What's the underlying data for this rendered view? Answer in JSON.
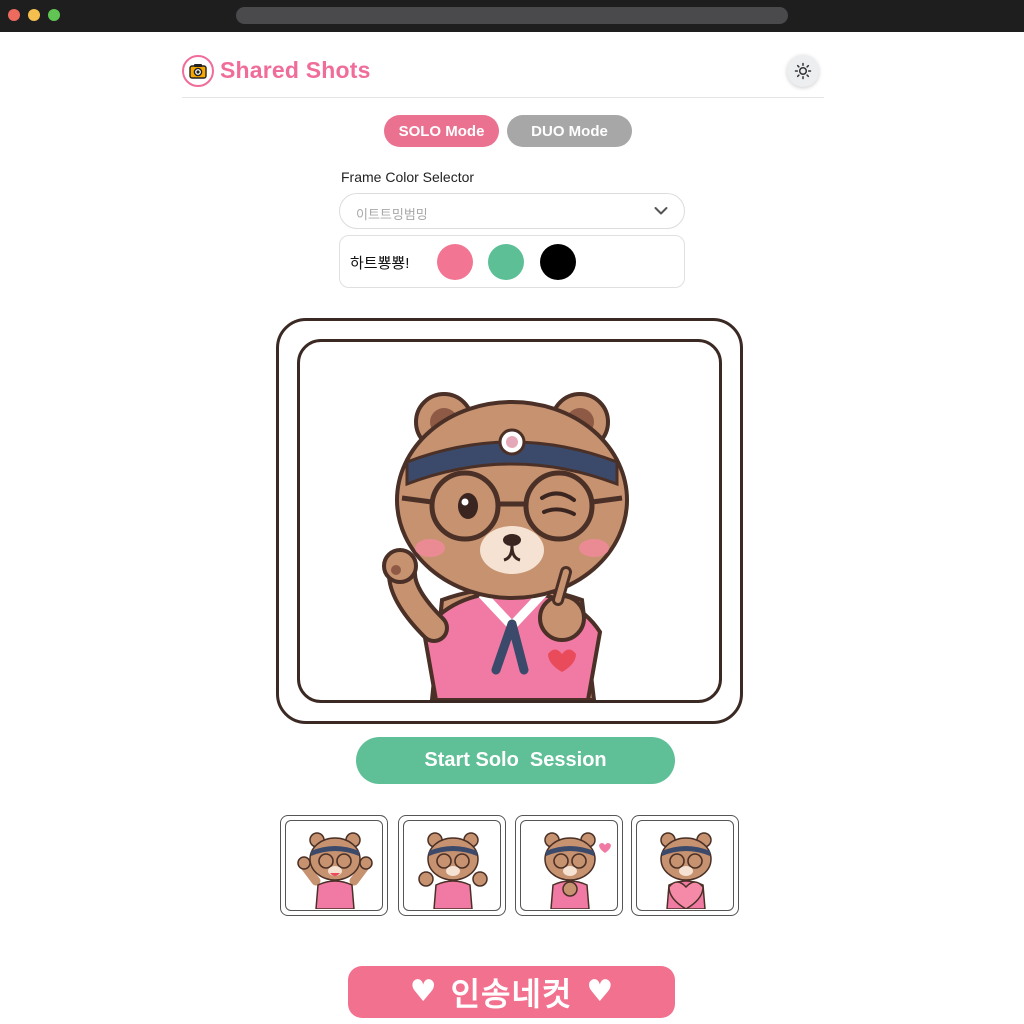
{
  "header": {
    "title": "Shared Shots",
    "logo_icon": "camera-icon",
    "theme_icon": "sun-icon"
  },
  "modes": {
    "solo_label": "SOLO Mode",
    "duo_label": "DUO Mode",
    "selected": "SOLO Mode"
  },
  "frame_selector": {
    "label": "Frame Color Selector",
    "selected_value": "이트트밍범밍",
    "swatch_label": "하트뿅뿅!",
    "swatches": [
      "#f27593",
      "#5cbf96",
      "#000000"
    ]
  },
  "preview": {
    "frame_color": "#3b2a24",
    "character": "bear-character"
  },
  "actions": {
    "start_label": "Start Solo  Session"
  },
  "thumbnails": {
    "count": 4,
    "poses": [
      "arms-raised",
      "thumbs-up",
      "finger-heart",
      "holding-heart"
    ]
  },
  "banner": {
    "text": "인송네컷",
    "heart_glyph": "♥"
  },
  "colors": {
    "brand_pink": "#f06c9b",
    "solo_pink": "#ea7290",
    "duo_gray": "#a7a7a7",
    "start_green": "#5fbf97",
    "banner_pink": "#f2718f"
  }
}
